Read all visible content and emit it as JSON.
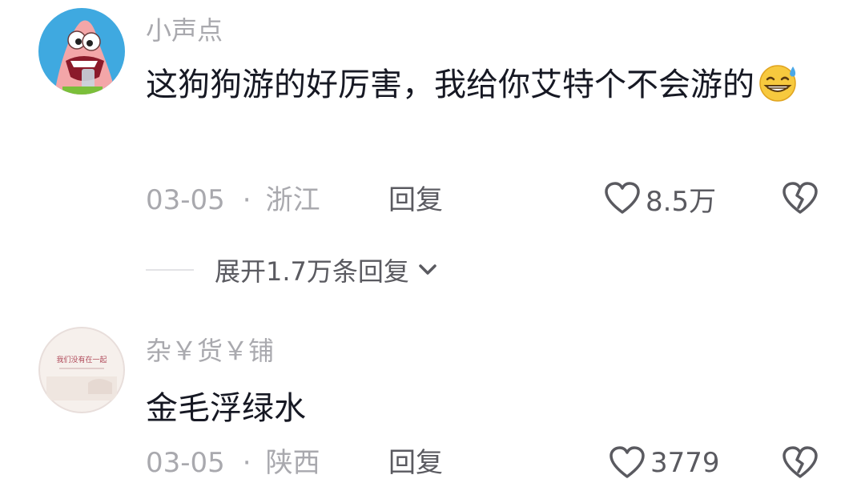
{
  "comments": [
    {
      "username": "小声点",
      "text": "这狗狗游的好厉害，我给你艾特个不会游的",
      "emoji": "grinning-sweat-emoji",
      "date": "03-05",
      "separator": "·",
      "location": "浙江",
      "reply_label": "回复",
      "likes": "8.5万",
      "expand_label": "展开1.7万条回复"
    },
    {
      "username": "杂￥货￥铺",
      "text": "金毛浮绿水",
      "date": "03-05",
      "separator": "·",
      "location": "陕西",
      "reply_label": "回复",
      "likes": "3779"
    }
  ],
  "avatar_text": "我们没有在一起",
  "colors": {
    "meta": "#a9a9ae",
    "text": "#161823",
    "action": "#5a5a60"
  }
}
